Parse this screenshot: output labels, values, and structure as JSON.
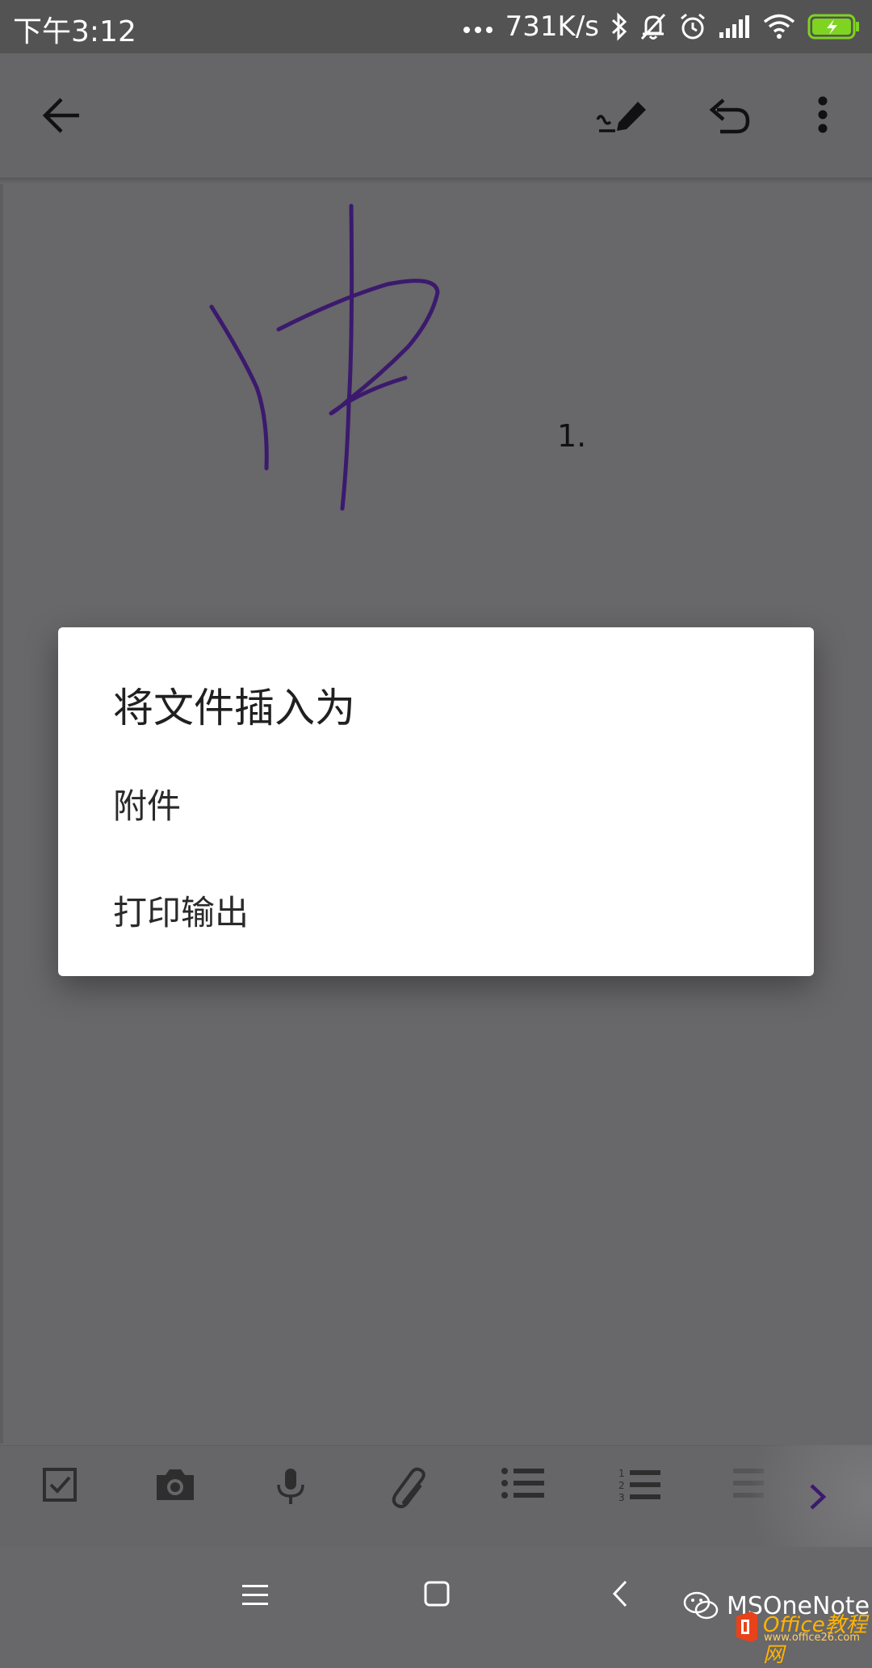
{
  "status_bar": {
    "time": "下午3:12",
    "speed": "731K/s",
    "icons": [
      "more-dots-icon",
      "bluetooth-icon",
      "bell-off-icon",
      "alarm-icon",
      "signal-icon",
      "wifi-icon",
      "battery-charging-icon"
    ]
  },
  "app_bar": {
    "icons": [
      "back-arrow-icon",
      "pen-icon",
      "undo-icon",
      "more-vert-icon"
    ]
  },
  "note": {
    "handwriting_color": "#3b1a6e",
    "list_number": "1."
  },
  "dialog": {
    "title": "将文件插入为",
    "options": [
      "附件",
      "打印输出"
    ]
  },
  "toolbar": {
    "icons": [
      "checkbox-icon",
      "camera-icon",
      "microphone-icon",
      "paperclip-icon",
      "bullet-list-icon",
      "numbered-list-icon",
      "indent-icon",
      "chevron-right-icon"
    ],
    "numbered_list_digits": [
      "1",
      "2",
      "3"
    ],
    "accent_color": "#3b1a6e"
  },
  "nav_bar": {
    "icons": [
      "menu-icon",
      "home-icon",
      "back-icon"
    ]
  },
  "watermark": {
    "text": "MSOneNote",
    "logo_text": "Office教程网",
    "logo_url": "www.office26.com"
  }
}
